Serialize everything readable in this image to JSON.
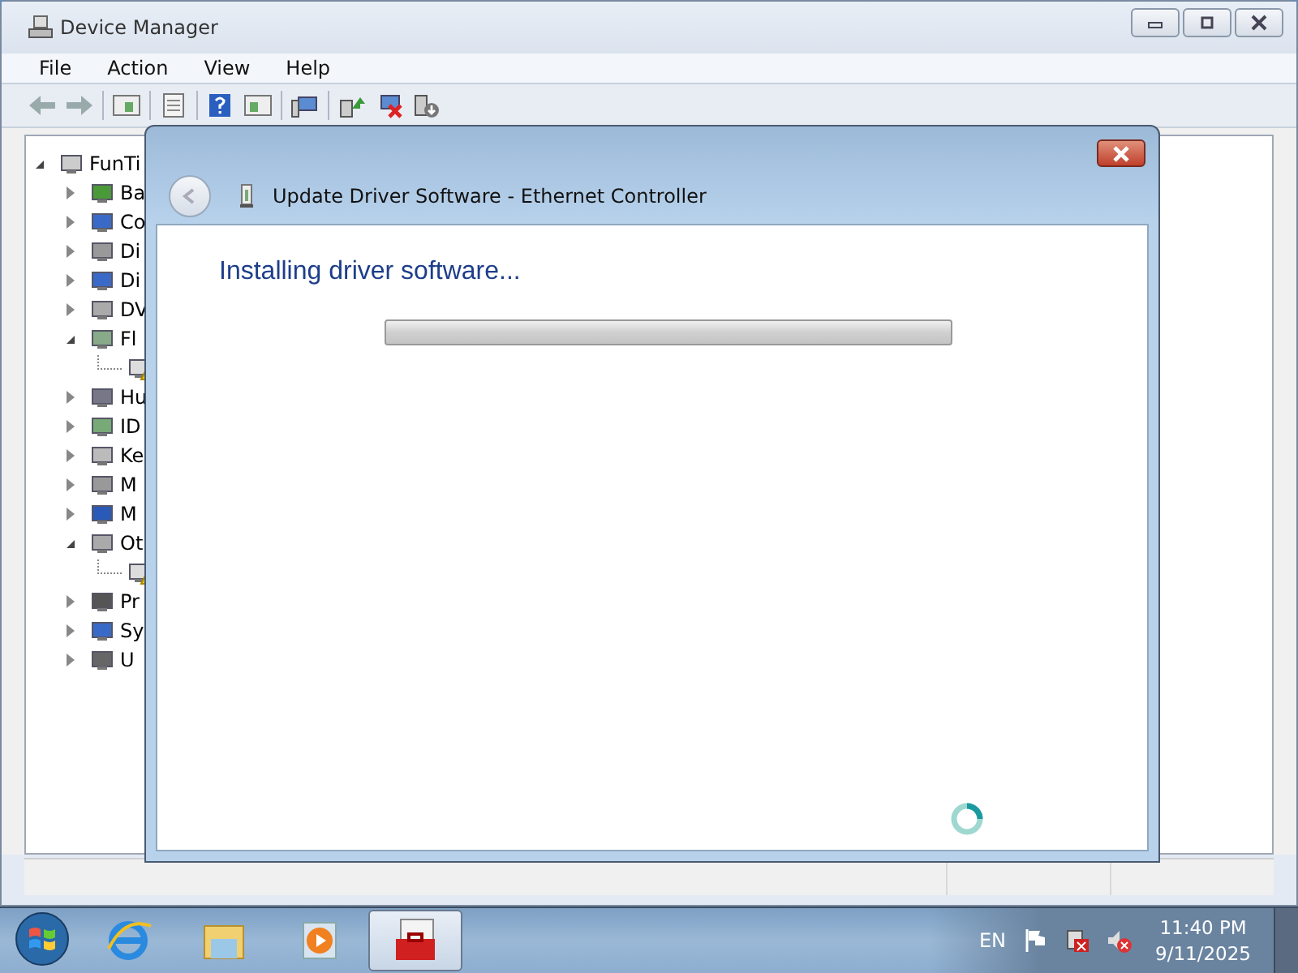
{
  "window": {
    "title": "Device Manager"
  },
  "menu": [
    "File",
    "Action",
    "View",
    "Help"
  ],
  "tree": {
    "label": "FunTi",
    "expanded": true,
    "children": [
      {
        "label": "Ba",
        "expanded": false
      },
      {
        "label": "Co",
        "expanded": false
      },
      {
        "label": "Di",
        "expanded": false
      },
      {
        "label": "Di",
        "expanded": false
      },
      {
        "label": "DV",
        "expanded": false
      },
      {
        "label": "Fl",
        "expanded": true,
        "children": [
          {
            "warning": true
          }
        ]
      },
      {
        "label": "Hu",
        "expanded": false
      },
      {
        "label": "ID",
        "expanded": false
      },
      {
        "label": "Ke",
        "expanded": false
      },
      {
        "label": "M",
        "expanded": false
      },
      {
        "label": "M",
        "expanded": false
      },
      {
        "label": "Ot",
        "expanded": true,
        "children": [
          {
            "warning": true
          }
        ]
      },
      {
        "label": "Pr",
        "expanded": false
      },
      {
        "label": "Sy",
        "expanded": false
      },
      {
        "label": "U",
        "expanded": false
      }
    ]
  },
  "dialog": {
    "title": "Update Driver Software - Ethernet Controller",
    "heading": "Installing driver software...",
    "progress": {
      "level": 0
    }
  },
  "taskbar": {
    "apps": [
      {
        "selected": false
      },
      {
        "selected": false
      },
      {
        "selected": false
      },
      {
        "selected": true
      }
    ],
    "language": "EN",
    "time": "11:40 PM",
    "date": "9/11/2025"
  }
}
